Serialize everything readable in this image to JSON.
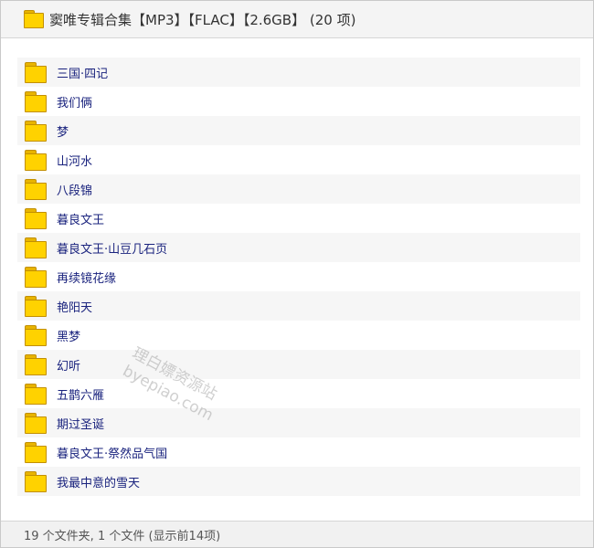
{
  "header": {
    "title": "窦唯专辑合集【MP3】【FLAC】【2.6GB】 (20 项)"
  },
  "folders": [
    {
      "label": "三国·四记"
    },
    {
      "label": "我们俩"
    },
    {
      "label": "梦"
    },
    {
      "label": "山河水"
    },
    {
      "label": "八段锦"
    },
    {
      "label": "暮良文王"
    },
    {
      "label": "暮良文王·山豆几石页"
    },
    {
      "label": "再续镜花缘"
    },
    {
      "label": "艳阳天"
    },
    {
      "label": "黑梦"
    },
    {
      "label": "幻听"
    },
    {
      "label": "五鹊六雁"
    },
    {
      "label": "期过圣诞"
    },
    {
      "label": "暮良文王·祭然品气国"
    },
    {
      "label": "我最中意的雪天"
    }
  ],
  "footer": {
    "status": "19 个文件夹, 1 个文件 (显示前14项)"
  },
  "watermark": {
    "line1": "理白嫖资源站",
    "line2": "byepiao.com"
  },
  "colors": {
    "folder_fill": "#ffd200",
    "folder_border": "#c28f00",
    "label_text": "#1a237e"
  }
}
